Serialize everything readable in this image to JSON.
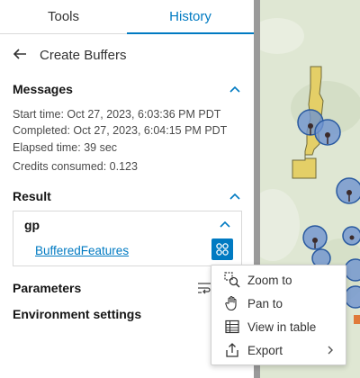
{
  "tabs": [
    {
      "label": "Tools"
    },
    {
      "label": "History"
    }
  ],
  "header": {
    "title": "Create Buffers"
  },
  "messages": {
    "title": "Messages",
    "lines": [
      "Start time: Oct 27, 2023, 6:03:36 PM PDT",
      "Completed: Oct 27, 2023, 6:04:15 PM PDT",
      "Elapsed time: 39 sec",
      "Credits consumed: 0.123"
    ]
  },
  "result": {
    "title": "Result",
    "group": "gp",
    "link": "BufferedFeatures"
  },
  "parameters": {
    "title": "Parameters"
  },
  "environment": {
    "title": "Environment settings"
  },
  "menu": {
    "items": [
      {
        "label": "Zoom to",
        "icon": "zoom-to-icon"
      },
      {
        "label": "Pan to",
        "icon": "pan-hand-icon"
      },
      {
        "label": "View in table",
        "icon": "table-icon"
      },
      {
        "label": "Export",
        "icon": "export-icon",
        "submenu": true
      }
    ]
  },
  "colors": {
    "accent": "#007ac2",
    "map_bg": "#dfe7d3",
    "buffer_fill": "#6f94cf",
    "polygon_fill": "#e4cf67"
  }
}
